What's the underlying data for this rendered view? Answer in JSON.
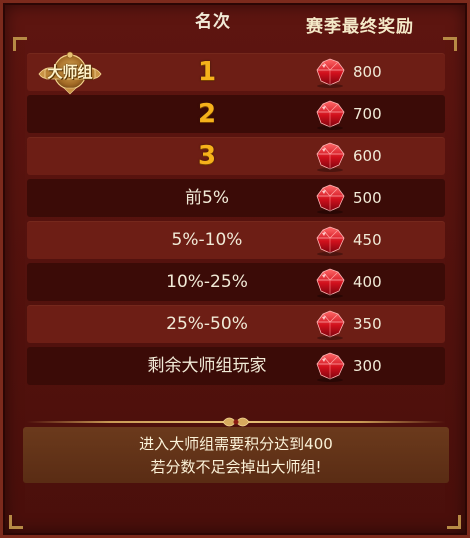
{
  "header": {
    "rank_label": "名次",
    "reward_label": "赛季最终奖励"
  },
  "badge": {
    "text": "大师组"
  },
  "rows": [
    {
      "rank": "1",
      "amount": "800"
    },
    {
      "rank": "2",
      "amount": "700"
    },
    {
      "rank": "3",
      "amount": "600"
    },
    {
      "rank": "前5%",
      "amount": "500"
    },
    {
      "rank": "5%-10%",
      "amount": "450"
    },
    {
      "rank": "10%-25%",
      "amount": "400"
    },
    {
      "rank": "25%-50%",
      "amount": "350"
    },
    {
      "rank": "剩余大师组玩家",
      "amount": "300"
    }
  ],
  "notice": {
    "line1": "进入大师组需要积分达到400",
    "line2": "若分数不足会掉出大师组!"
  },
  "reward_icon": "red-gem-icon",
  "colors": {
    "gold": "#f6b21b",
    "panel": "#4a0f0b",
    "row_light": "#6d1e15",
    "row_dark": "#3b0b07"
  }
}
